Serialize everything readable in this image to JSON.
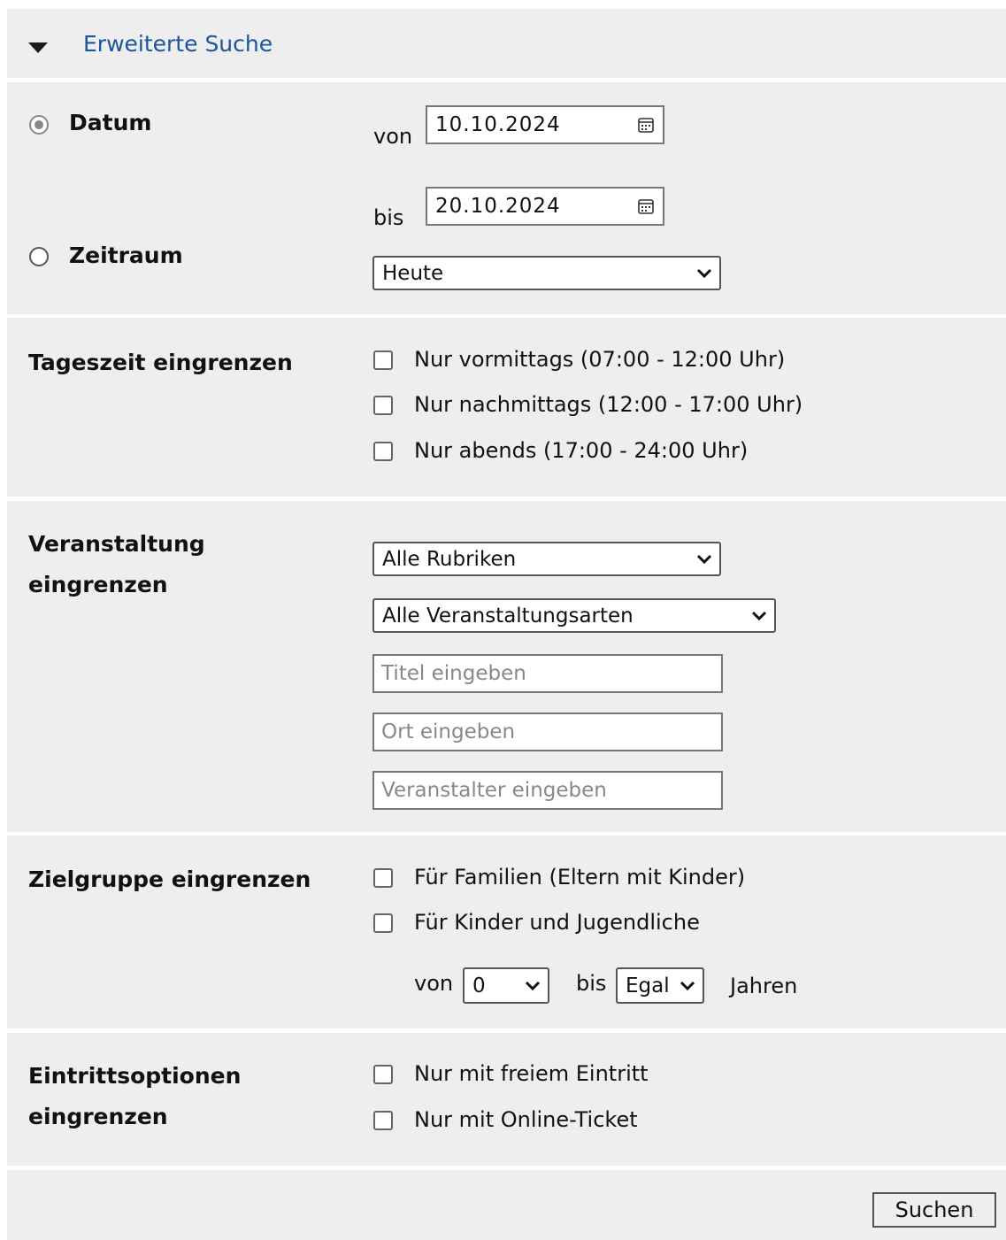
{
  "header": {
    "toggle_icon": "caret-down-icon",
    "title": "Erweiterte Suche",
    "link_color": "#1a56a0"
  },
  "datum": {
    "radio_label": "Datum",
    "von_label": "von",
    "von_value": "10.10.2024",
    "bis_label": "bis",
    "bis_value": "20.10.2024",
    "calendar_icon": "calendar-icon"
  },
  "zeitraum": {
    "radio_label": "Zeitraum",
    "selected": "Heute"
  },
  "tageszeit": {
    "label": "Tageszeit eingrenzen",
    "options": [
      "Nur vormittags (07:00 - 12:00 Uhr)",
      "Nur nachmittags (12:00 - 17:00 Uhr)",
      "Nur abends (17:00 - 24:00 Uhr)"
    ]
  },
  "veranstaltung": {
    "label_line1": "Veranstaltung",
    "label_line2": "eingrenzen",
    "rubrik_selected": "Alle Rubriken",
    "art_selected": "Alle Veranstaltungsarten",
    "titel_placeholder": "Titel eingeben",
    "ort_placeholder": "Ort eingeben",
    "veranstalter_placeholder": "Veranstalter eingeben"
  },
  "zielgruppe": {
    "label": "Zielgruppe eingrenzen",
    "options": [
      "Für Familien (Eltern mit Kinder)",
      "Für Kinder und Jugendliche"
    ],
    "von_label": "von",
    "von_selected": "0",
    "bis_label": "bis",
    "bis_selected": "Egal",
    "jahren_label": "Jahren"
  },
  "eintritt": {
    "label_line1": "Eintrittsoptionen",
    "label_line2": "eingrenzen",
    "options": [
      "Nur mit freiem Eintritt",
      "Nur mit Online-Ticket"
    ]
  },
  "submit": {
    "label": "Suchen"
  }
}
